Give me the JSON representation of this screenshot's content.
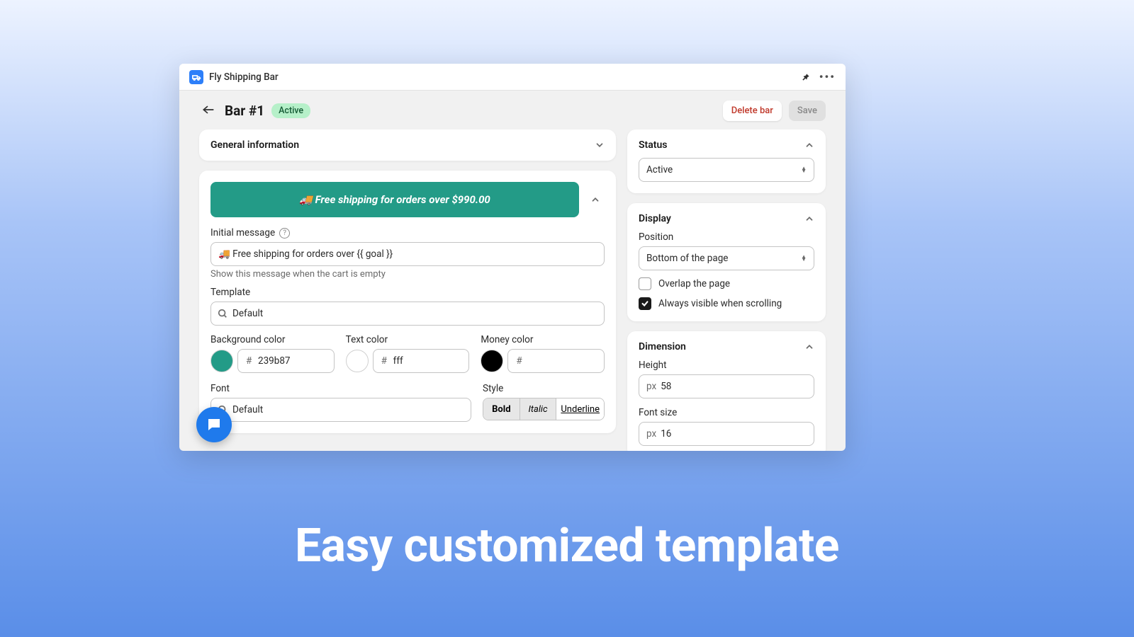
{
  "backdrop_title": "Easy customized template",
  "app": {
    "name": "Fly Shipping Bar"
  },
  "header": {
    "title": "Bar #1",
    "status_badge": "Active",
    "delete_label": "Delete bar",
    "save_label": "Save"
  },
  "general_info": {
    "title": "General information"
  },
  "message": {
    "preview": "🚚 Free shipping for orders over $990.00",
    "initial_label": "Initial message",
    "initial_value": "🚚 Free shipping for orders over {{ goal }}",
    "initial_helper": "Show this message when the cart is empty",
    "template_label": "Template",
    "template_value": "Default",
    "bg_label": "Background color",
    "bg_value": "239b87",
    "text_label": "Text color",
    "text_value": "fff",
    "money_label": "Money color",
    "money_value": "",
    "font_label": "Font",
    "font_value": "Default",
    "style_label": "Style",
    "style_bold": "Bold",
    "style_italic": "Italic",
    "style_underline": "Underline"
  },
  "status": {
    "title": "Status",
    "value": "Active"
  },
  "display": {
    "title": "Display",
    "position_label": "Position",
    "position_value": "Bottom of the page",
    "overlap_label": "Overlap the page",
    "always_visible_label": "Always visible when scrolling"
  },
  "dimension": {
    "title": "Dimension",
    "height_label": "Height",
    "height_unit": "px",
    "height_value": "58",
    "fontsize_label": "Font size",
    "fontsize_unit": "px",
    "fontsize_value": "16"
  },
  "colors": {
    "bg_swatch": "#239b87",
    "text_swatch": "#ffffff",
    "money_swatch": "#000000"
  }
}
